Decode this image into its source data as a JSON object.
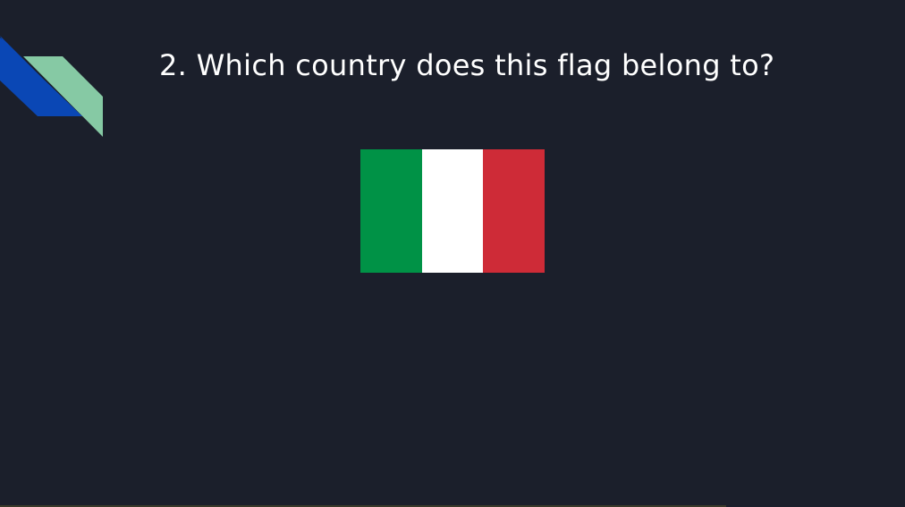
{
  "slide": {
    "title": "2. Which country does this flag belong to?",
    "background_color": "#1b1f2b"
  },
  "decoration": {
    "blue_ribbon_color": "#0a47b5",
    "green_ribbon_color": "#86c9a4"
  },
  "flag": {
    "icon": "italy-flag-icon",
    "stripes": [
      {
        "color": "#009246"
      },
      {
        "color": "#ffffff"
      },
      {
        "color": "#ce2b37"
      }
    ]
  }
}
